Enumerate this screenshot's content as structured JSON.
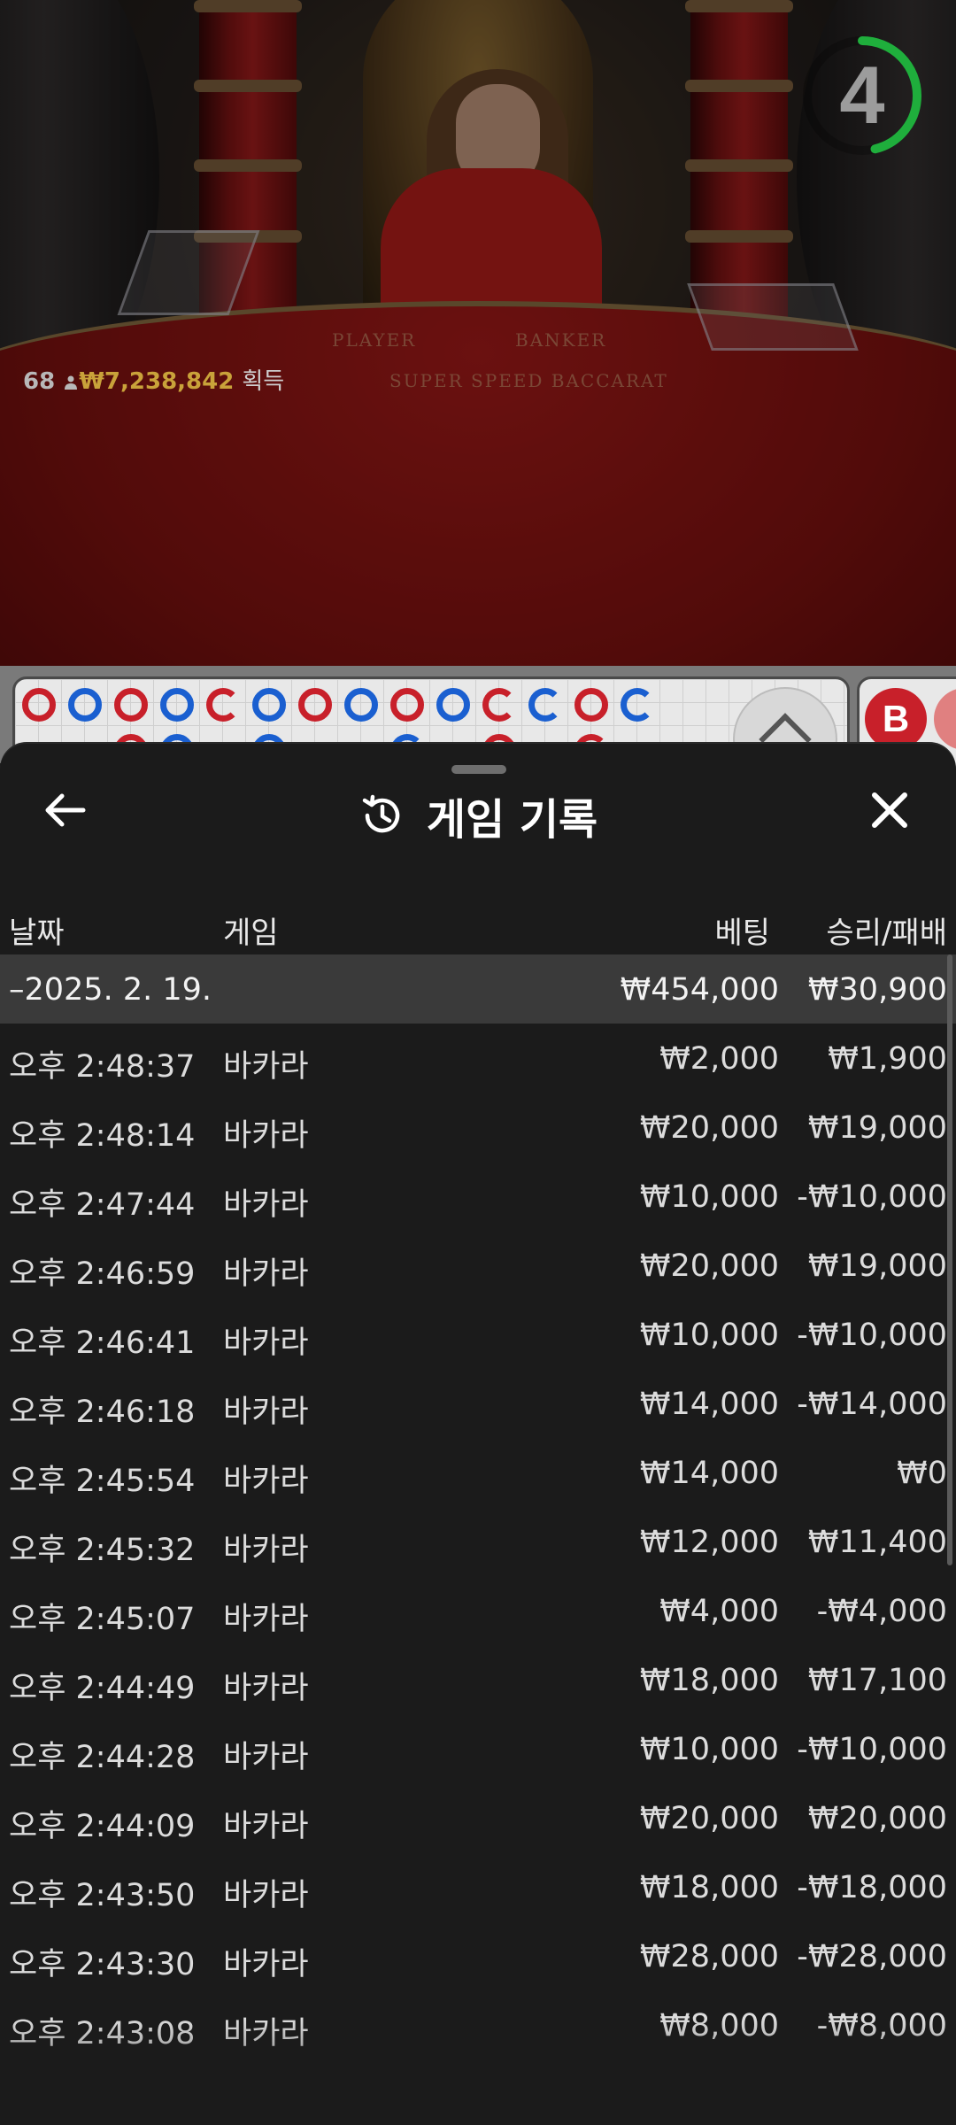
{
  "video": {
    "table_label_player": "PLAYER",
    "table_label_banker": "BANKER",
    "table_label_game": "SUPER SPEED BACCARAT",
    "players_count": "68",
    "win_amount": "₩7,238,842",
    "win_label": "획득",
    "timer_value": "4",
    "timer_color": "#1fae3c"
  },
  "roadmap": {
    "predict_label": "B",
    "banker_color": "#c8202a",
    "player_color": "#1a5fd0"
  },
  "sheet": {
    "title": "게임 기록",
    "back_icon": "arrow-left-icon",
    "history_icon": "history-icon",
    "close_icon": "close-icon",
    "columns": {
      "date": "날짜",
      "game": "게임",
      "bet": "베팅",
      "win_loss": "승리/패배"
    },
    "summary": {
      "date": "–2025. 2. 19.",
      "bet": "₩454,000",
      "win_loss": "₩30,900"
    },
    "rows": [
      {
        "time": "오후 2:48:37",
        "game": "바카라",
        "bet": "₩2,000",
        "win_loss": "₩1,900"
      },
      {
        "time": "오후 2:48:14",
        "game": "바카라",
        "bet": "₩20,000",
        "win_loss": "₩19,000"
      },
      {
        "time": "오후 2:47:44",
        "game": "바카라",
        "bet": "₩10,000",
        "win_loss": "-₩10,000"
      },
      {
        "time": "오후 2:46:59",
        "game": "바카라",
        "bet": "₩20,000",
        "win_loss": "₩19,000"
      },
      {
        "time": "오후 2:46:41",
        "game": "바카라",
        "bet": "₩10,000",
        "win_loss": "-₩10,000"
      },
      {
        "time": "오후 2:46:18",
        "game": "바카라",
        "bet": "₩14,000",
        "win_loss": "-₩14,000"
      },
      {
        "time": "오후 2:45:54",
        "game": "바카라",
        "bet": "₩14,000",
        "win_loss": "₩0"
      },
      {
        "time": "오후 2:45:32",
        "game": "바카라",
        "bet": "₩12,000",
        "win_loss": "₩11,400"
      },
      {
        "time": "오후 2:45:07",
        "game": "바카라",
        "bet": "₩4,000",
        "win_loss": "-₩4,000"
      },
      {
        "time": "오후 2:44:49",
        "game": "바카라",
        "bet": "₩18,000",
        "win_loss": "₩17,100"
      },
      {
        "time": "오후 2:44:28",
        "game": "바카라",
        "bet": "₩10,000",
        "win_loss": "-₩10,000"
      },
      {
        "time": "오후 2:44:09",
        "game": "바카라",
        "bet": "₩20,000",
        "win_loss": "₩20,000"
      },
      {
        "time": "오후 2:43:50",
        "game": "바카라",
        "bet": "₩18,000",
        "win_loss": "-₩18,000"
      },
      {
        "time": "오후 2:43:30",
        "game": "바카라",
        "bet": "₩28,000",
        "win_loss": "-₩28,000"
      },
      {
        "time": "오후 2:43:08",
        "game": "바카라",
        "bet": "₩8,000",
        "win_loss": "-₩8,000"
      }
    ]
  }
}
